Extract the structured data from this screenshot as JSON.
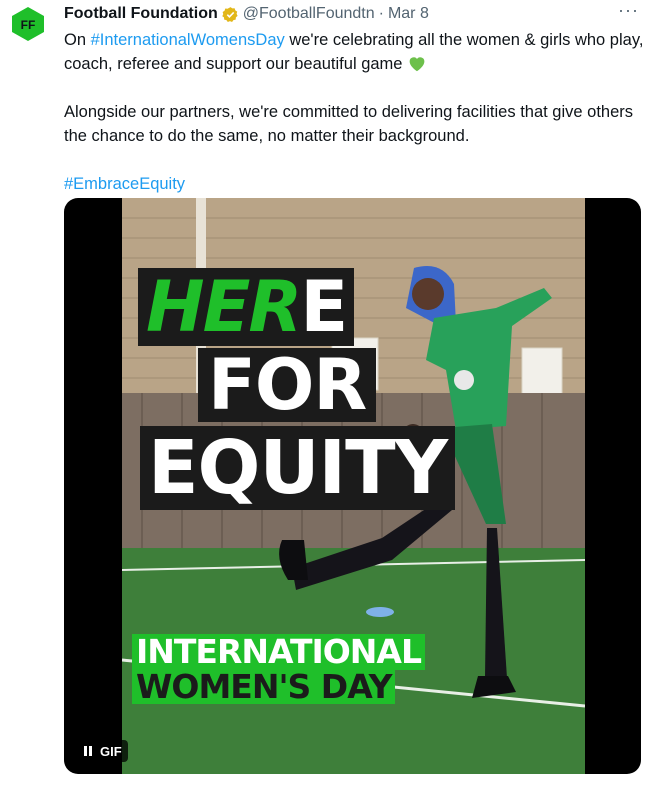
{
  "author": {
    "avatar_text": "FF",
    "name": "Football Foundation",
    "handle": "@FootballFoundtn",
    "separator": "·",
    "date": "Mar 8"
  },
  "more_menu": "···",
  "tweet": {
    "line1_pre": "On ",
    "hashtag1": "#InternationalWomensDay",
    "line1_post": " we're celebrating all the women & girls who play, coach, referee and support our beautiful game ",
    "para2": "Alongside our partners, we're committed to delivering facilities that give others the chance to do the same, no matter their background.",
    "hashtag2": "#EmbraceEquity"
  },
  "media": {
    "overlay_here_green": "HER",
    "overlay_here_white": "E",
    "overlay_for": "FOR",
    "overlay_equity": "EQUITY",
    "overlay_iwd_line1": "INTERNATIONAL",
    "overlay_iwd_line2": "WOMEN'S DAY",
    "gif_label": "GIF"
  },
  "colors": {
    "brand_green": "#1fbf2a",
    "link_blue": "#1d9bf0",
    "verified_gold": "#e2b719"
  }
}
